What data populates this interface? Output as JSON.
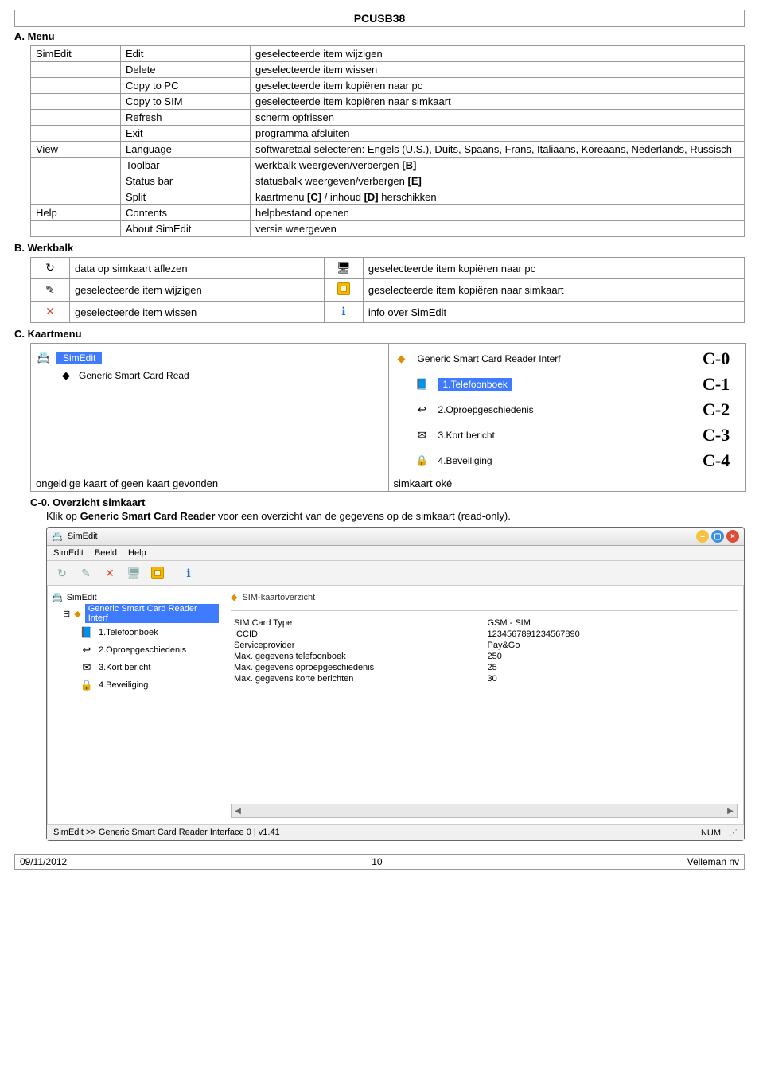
{
  "header": {
    "title": "PCUSB38"
  },
  "menu": {
    "title": "A. Menu",
    "rows": [
      {
        "group": "SimEdit",
        "item": "Edit",
        "desc": "geselecteerde item wijzigen"
      },
      {
        "group": "",
        "item": "Delete",
        "desc": "geselecteerde item wissen"
      },
      {
        "group": "",
        "item": "Copy to PC",
        "desc": "geselecteerde item kopiëren naar pc"
      },
      {
        "group": "",
        "item": "Copy to SIM",
        "desc": "geselecteerde item kopiëren naar simkaart"
      },
      {
        "group": "",
        "item": "Refresh",
        "desc": "scherm opfrissen"
      },
      {
        "group": "",
        "item": "Exit",
        "desc": "programma afsluiten"
      },
      {
        "group": "View",
        "item": "Language",
        "desc": "softwaretaal selecteren: Engels (U.S.), Duits, Spaans, Frans, Italiaans, Koreaans, Nederlands, Russisch"
      },
      {
        "group": "",
        "item": "Toolbar",
        "desc_html": "werkbalk weergeven/verbergen <b>[B]</b>"
      },
      {
        "group": "",
        "item": "Status bar",
        "desc_html": "statusbalk weergeven/verbergen <b>[E]</b>"
      },
      {
        "group": "",
        "item": "Split",
        "desc_html": "kaartmenu <b>[C]</b> / inhoud <b>[D]</b> herschikken"
      },
      {
        "group": "Help",
        "item": "Contents",
        "desc": "helpbestand openen"
      },
      {
        "group": "",
        "item": "About SimEdit",
        "desc": "versie weergeven"
      }
    ]
  },
  "werkbalk": {
    "title": "B. Werkbalk",
    "rows": [
      [
        {
          "icon": "refresh-icon",
          "glyph": "↻",
          "text": "data op simkaart aflezen"
        },
        {
          "icon": "pc-icon",
          "glyph": "🖥",
          "text": "geselecteerde item kopiëren naar pc"
        }
      ],
      [
        {
          "icon": "edit-icon",
          "glyph": "✎",
          "text": "geselecteerde item wijzigen"
        },
        {
          "icon": "sim-icon",
          "glyph": "",
          "text": "geselecteerde item kopiëren naar simkaart"
        }
      ],
      [
        {
          "icon": "delete-icon",
          "glyph": "✕",
          "text": "geselecteerde item wissen",
          "color": "#d94f3a"
        },
        {
          "icon": "info-icon",
          "glyph": "ℹ",
          "text": "info over SimEdit",
          "color": "#2b6fd6"
        }
      ]
    ]
  },
  "kaartmenu": {
    "title": "C. Kaartmenu",
    "left_root": "SimEdit",
    "left_child": "Generic Smart Card Read",
    "left_caption": "ongeldige kaart of geen kaart gevonden",
    "right_root": "Generic Smart Card Reader Interf",
    "right_items": [
      {
        "icon": "📘",
        "label": "1.Telefoonboek",
        "highlight": true,
        "c": "C-1"
      },
      {
        "icon": "↩",
        "label": "2.Oproepgeschiedenis",
        "c": "C-2"
      },
      {
        "icon": "✉",
        "label": "3.Kort bericht",
        "c": "C-3"
      },
      {
        "icon": "🔒",
        "label": "4.Beveiliging",
        "c": "C-4"
      }
    ],
    "right_root_c": "C-0",
    "right_caption": "simkaart oké"
  },
  "overzicht": {
    "title": "C-0. Overzicht simkaart",
    "desc_pre": "Klik op ",
    "desc_bold": "Generic Smart Card Reader",
    "desc_post": " voor een overzicht van de gegevens op de simkaart (read-only).",
    "window": {
      "title": "SimEdit",
      "menubar": [
        "SimEdit",
        "Beeld",
        "Help"
      ],
      "tree_root": "SimEdit",
      "tree_sel": "Generic Smart Card Reader Interf",
      "tree_items": [
        "1.Telefoonboek",
        "2.Oproepgeschiedenis",
        "3.Kort bericht",
        "4.Beveiliging"
      ],
      "panel_title": "SIM-kaartoverzicht",
      "props": [
        [
          "SIM Card Type",
          "GSM - SIM"
        ],
        [
          "ICCID",
          "1234567891234567890"
        ],
        [
          "Serviceprovider",
          "Pay&Go"
        ],
        [
          "Max. gegevens telefoonboek",
          "250"
        ],
        [
          "Max. gegevens oproepgeschiedenis",
          "25"
        ],
        [
          "Max. gegevens korte berichten",
          "30"
        ]
      ],
      "status_left": "SimEdit  >>  Generic Smart Card Reader Interface 0 | v1.41",
      "status_num": "NUM"
    }
  },
  "footer": {
    "left": "09/11/2012",
    "mid": "10",
    "right": "Velleman nv"
  }
}
